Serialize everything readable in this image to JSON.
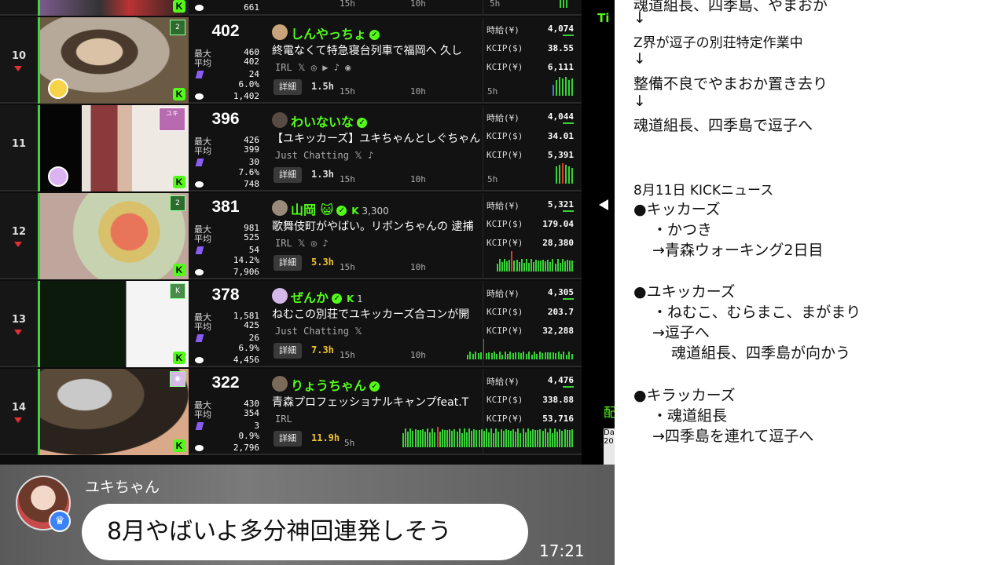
{
  "top_row": {
    "viewers_last": "661",
    "dur_ticks": [
      "15h",
      "10h",
      "5h"
    ]
  },
  "rows": [
    {
      "rank": "10",
      "viewers": "402",
      "max": "460",
      "avg": "402",
      "purple": "24",
      "pct": "6.0%",
      "total": "1,402",
      "name": "しんやっちょ",
      "kick_count": "",
      "title": "終電なくて特急寝台列車で福岡へ 久し",
      "category": "IRL",
      "detail": "詳細",
      "duration": "1.5h",
      "hourly_label": "時給(¥)",
      "hourly": "4,074",
      "kcip_usd_label": "KCIP($)",
      "kcip_usd": "38.55",
      "kcip_jpy_label": "KCIP(¥)",
      "kcip_jpy": "6,111",
      "ticks": [
        "15h",
        "10h",
        "5h"
      ]
    },
    {
      "rank": "11",
      "viewers": "396",
      "max": "426",
      "avg": "399",
      "purple": "30",
      "pct": "7.6%",
      "total": "748",
      "name": "わいないな",
      "kick_count": "",
      "title": "【ユキッカーズ】ユキちゃんとしぐちゃんと",
      "category": "Just Chatting",
      "detail": "詳細",
      "duration": "1.3h",
      "hourly_label": "時給(¥)",
      "hourly": "4,044",
      "kcip_usd_label": "KCIP($)",
      "kcip_usd": "34.01",
      "kcip_jpy_label": "KCIP(¥)",
      "kcip_jpy": "5,391",
      "ticks": [
        "15h",
        "10h",
        "5h"
      ]
    },
    {
      "rank": "12",
      "viewers": "381",
      "max": "981",
      "avg": "525",
      "purple": "54",
      "pct": "14.2%",
      "total": "7,906",
      "name": "山岡",
      "kick_count": "3,300",
      "title": "歌舞伎町がやばい。リボンちゃんの 逮捕",
      "category": "IRL",
      "detail": "詳細",
      "duration": "5.3h",
      "hourly_label": "時給(¥)",
      "hourly": "5,321",
      "kcip_usd_label": "KCIP($)",
      "kcip_usd": "179.04",
      "kcip_jpy_label": "KCIP(¥)",
      "kcip_jpy": "28,380",
      "ticks": [
        "15h",
        "10h"
      ]
    },
    {
      "rank": "13",
      "viewers": "378",
      "max": "1,581",
      "avg": "425",
      "purple": "26",
      "pct": "6.9%",
      "total": "4,456",
      "name": "ぜんか",
      "kick_count": "1",
      "title": "ねむこの別荘でユキッカーズ合コンが開",
      "category": "Just Chatting",
      "detail": "詳細",
      "duration": "7.3h",
      "hourly_label": "時給(¥)",
      "hourly": "4,305",
      "kcip_usd_label": "KCIP($)",
      "kcip_usd": "203.7",
      "kcip_jpy_label": "KCIP(¥)",
      "kcip_jpy": "32,288",
      "ticks": [
        "15h",
        "10h"
      ]
    },
    {
      "rank": "14",
      "viewers": "322",
      "max": "430",
      "avg": "354",
      "purple": "3",
      "pct": "0.9%",
      "total": "2,796",
      "name": "りょうちゃん",
      "kick_count": "",
      "title": "青森プロフェッショナルキャンプfeat.T",
      "category": "IRL",
      "detail": "詳細",
      "duration": "11.9h",
      "hourly_label": "時給(¥)",
      "hourly": "4,476",
      "kcip_usd_label": "KCIP($)",
      "kcip_usd": "338.88",
      "kcip_jpy_label": "KCIP(¥)",
      "kcip_jpy": "53,716",
      "ticks": [
        "5h"
      ]
    }
  ],
  "stat_labels": {
    "max": "最大",
    "avg": "平均"
  },
  "mid": {
    "ti": "Ti",
    "bits": "配",
    "box": "Da\n20"
  },
  "news": {
    "lines": [
      "魂道組長、四季島、やまおか",
      "↓",
      "Z界が逗子の別荘特定作業中",
      "↓",
      "整備不良でやまおか置き去り",
      "↓",
      "魂道組長、四季島で逗子へ",
      "8月11日 KICKニュース",
      "●キッカーズ",
      "・かつき",
      "→青森ウォーキング2日目",
      "●ユキッカーズ",
      "・ねむこ、むらまこ、まがまり",
      "→逗子へ",
      "魂道組長、四季島が向かう",
      "●キラッカーズ",
      "・魂道組長",
      "→四季島を連れて逗子へ"
    ]
  },
  "chat": {
    "name": "ユキちゃん",
    "message": "8月やばいよ多分神回連発しそう",
    "time": "17:21"
  },
  "colors": {
    "kick_green": "#53fc18",
    "accent_red": "#e03030",
    "duration_yellow": "#f2c12e"
  }
}
